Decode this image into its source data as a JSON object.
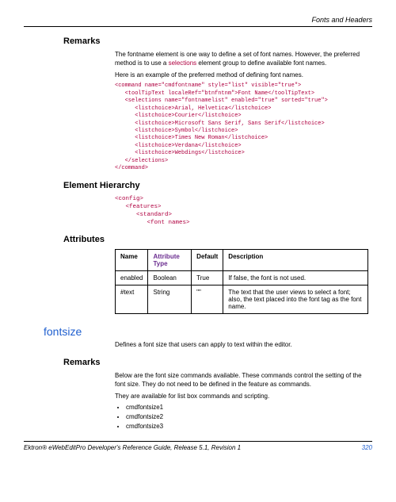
{
  "header": {
    "running": "Fonts and Headers"
  },
  "sections": {
    "remarks1": {
      "heading": "Remarks",
      "para1_a": "The fontname element is one way to define a set of font names. However, the preferred method is to use a ",
      "para1_link": "selections",
      "para1_b": " element group to define available font names.",
      "para2": "Here is an example of the preferred method of defining font names.",
      "code": "<command name=\"cmdfontname\" style=\"list\" visible=\"true\">\n   <toolTipText localeRef=\"btnfntnm\">Font Name</toolTipText>\n   <selections name=\"fontnamelist\" enabled=\"true\" sorted=\"true\">\n      <listchoice>Arial, Helvetica</listchoice>\n      <listchoice>Courier</listchoice>\n      <listchoice>Microsoft Sans Serif, Sans Serif</listchoice>\n      <listchoice>Symbol</listchoice>\n      <listchoice>Times New Roman</listchoice>\n      <listchoice>Verdana</listchoice>\n      <listchoice>Webdings</listchoice>\n   </selections>\n</command>"
    },
    "hierarchy": {
      "heading": "Element Hierarchy",
      "code": "<config>\n   <features>\n      <standard>\n         <font names>"
    },
    "attributes": {
      "heading": "Attributes",
      "table": {
        "head": {
          "name": "Name",
          "attrtype": "Attribute Type",
          "default": "Default",
          "desc": "Description"
        },
        "rows": [
          {
            "name": "enabled",
            "type": "Boolean",
            "default": "True",
            "desc": "If false, the font is not used."
          },
          {
            "name": "#text",
            "type": "String",
            "default": "\"\"",
            "desc": "The text that the user views to select a font; also, the text placed into the font tag as the font name."
          }
        ]
      }
    },
    "fontsize": {
      "heading": "fontsize",
      "intro": "Defines a font size that users can apply to text within the editor.",
      "remarks_heading": "Remarks",
      "para1": "Below are the font size commands available. These commands control the setting of the font size. They do not need to be defined in the feature as commands.",
      "para2": "They are available for list box commands and scripting.",
      "bullets": [
        "cmdfontsize1",
        "cmdfontsize2",
        "cmdfontsize3"
      ]
    }
  },
  "footer": {
    "text": "Ektron® eWebEditPro Developer's Reference Guide, Release 5.1, Revision 1",
    "page": "320"
  }
}
